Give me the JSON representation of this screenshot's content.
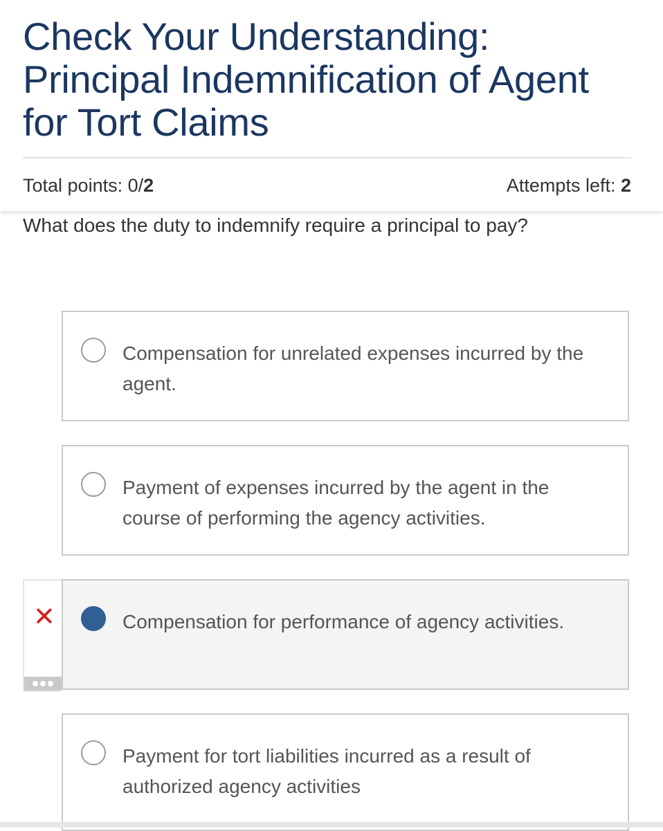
{
  "header": {
    "title": "Check Your Understanding: Principal Indemnification of Agent for Tort Claims",
    "points_label": "Total points: 0/",
    "points_total": "2",
    "attempts_label": "Attempts left: ",
    "attempts_value": "2"
  },
  "question": "What does the duty to indemnify require a principal to pay?",
  "choices": [
    {
      "text": "Compensation for unrelated expenses incurred by the agent."
    },
    {
      "text": "Payment of expenses incurred by the agent in the course of performing the agency activities."
    },
    {
      "text": "Compensation for performance of agency activities."
    },
    {
      "text": "Payment for tort liabilities incurred as a result of authorized agency activities"
    }
  ],
  "selected_choice": "Compensation for performance of agency activities.",
  "feedback": {
    "icon": "x-icon",
    "status": "incorrect"
  },
  "colors": {
    "title": "#1b3761",
    "selected_radio": "#2f5f93",
    "incorrect": "#d0201e"
  }
}
